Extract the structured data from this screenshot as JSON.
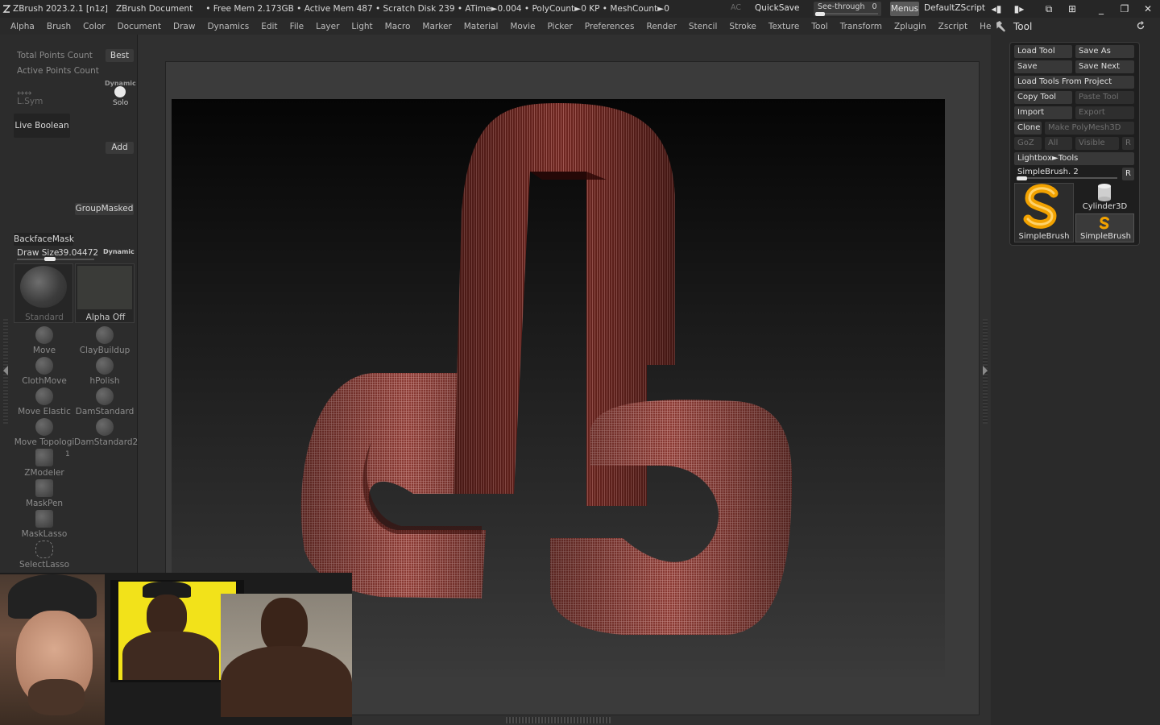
{
  "titlebar": {
    "app": "ZBrush 2023.2.1 [n1z]",
    "document": "ZBrush Document",
    "stats": "• Free Mem 2.173GB • Active Mem 487 • Scratch Disk 239 • ATime►0.004 • PolyCount►0 KP • MeshCount►0",
    "ac": "AC",
    "quicksave": "QuickSave",
    "see_through_label": "See-through",
    "see_through_value": "0",
    "menus": "Menus",
    "script": "DefaultZScript"
  },
  "menubar": [
    "Alpha",
    "Brush",
    "Color",
    "Document",
    "Draw",
    "Dynamics",
    "Edit",
    "File",
    "Layer",
    "Light",
    "Macro",
    "Marker",
    "Material",
    "Movie",
    "Picker",
    "Preferences",
    "Render",
    "Stencil",
    "Stroke",
    "Texture",
    "Tool",
    "Transform",
    "Zplugin",
    "Zscript",
    "Help"
  ],
  "tool_header": "Tool",
  "left": {
    "total_points": "Total Points Count",
    "best": "Best",
    "active_points": "Active Points Count",
    "dynamic_small": "Dynamic",
    "lsym": "L.Sym",
    "solo": "Solo",
    "live_boolean": "Live Boolean",
    "add": "Add",
    "groupmasked": "GroupMasked",
    "backfacemask": "BackfaceMask",
    "draw_size_label": "Draw Size",
    "draw_size_value": "39.04472",
    "dynamic": "Dynamic",
    "standard": "Standard",
    "alpha_off": "Alpha Off",
    "brushes": [
      {
        "l": "Move",
        "r": "ClayBuildup"
      },
      {
        "l": "ClothMove",
        "r": "hPolish"
      },
      {
        "l": "Move Elastic",
        "r": "DamStandard"
      },
      {
        "l": "Move Topologi",
        "r": "DamStandard2"
      }
    ],
    "zmodeler": "ZModeler",
    "zmodeler_num": "1",
    "maskpen": "MaskPen",
    "masklasso": "MaskLasso",
    "selectlasso": "SelectLasso"
  },
  "toolpanel": {
    "load_tool": "Load Tool",
    "save_as": "Save As",
    "save": "Save",
    "save_next": "Save Next",
    "load_from_project": "Load Tools From Project",
    "copy_tool": "Copy Tool",
    "paste_tool": "Paste Tool",
    "import": "Import",
    "export": "Export",
    "clone": "Clone",
    "make_polymesh": "Make PolyMesh3D",
    "goz": "GoZ",
    "all": "All",
    "visible": "Visible",
    "r": "R",
    "lightbox_tools": "Lightbox►Tools",
    "simplebrush_slider": "SimpleBrush. 2",
    "thumb_main": "SimpleBrush",
    "thumb_cyl": "Cylinder3D",
    "thumb_small": "SimpleBrush"
  },
  "colors": {
    "mesh": "#7a2a24",
    "mesh_light": "#b26a64",
    "accent": "#f2a200"
  }
}
